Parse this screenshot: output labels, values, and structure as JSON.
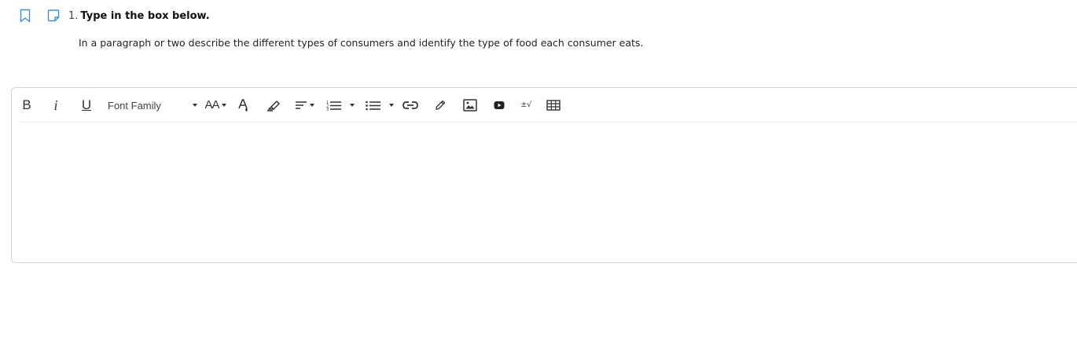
{
  "question": {
    "number": "1.",
    "title": "Type in the box below.",
    "prompt": "In a paragraph or two describe the different types of consumers and identify the type of food each consumer eats."
  },
  "icons": {
    "bookmark": "bookmark-icon",
    "note": "note-icon",
    "accent_color": "#3b8fd8"
  },
  "editor": {
    "toolbar": {
      "bold_label": "B",
      "italic_label": "i",
      "underline_label": "U",
      "font_family_label": "Font Family",
      "font_size_label": "AA",
      "math_label": "±√"
    },
    "content": ""
  }
}
